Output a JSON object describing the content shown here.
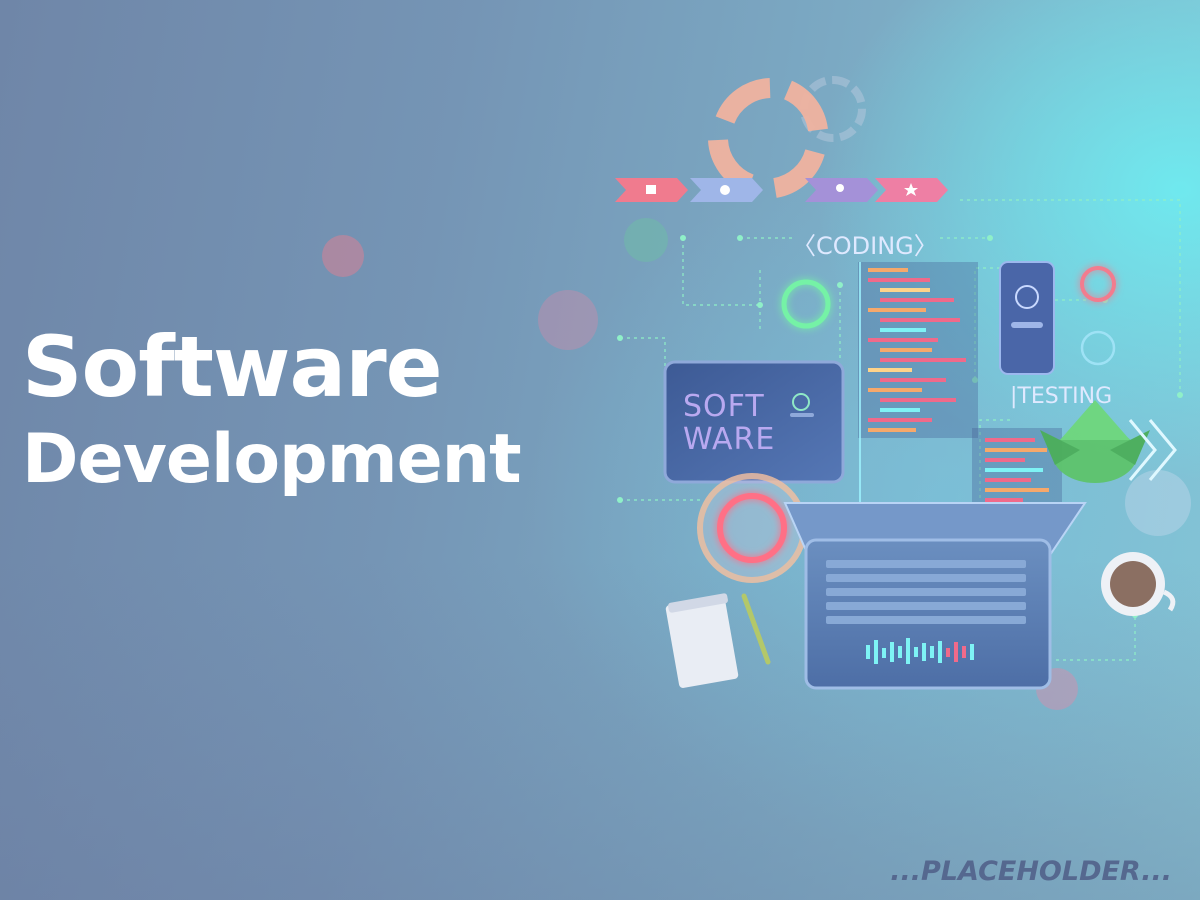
{
  "hero": {
    "title_line1": "Software",
    "title_line2": "Development"
  },
  "illustration": {
    "coding_label": "〈CODING〉",
    "testing_label": "|TESTING",
    "software_label": "SOFT\nWARE",
    "arrow_icons": [
      "home-icon",
      "chart-icon",
      "location-pin-icon",
      "star-icon"
    ]
  },
  "watermark": "...PLACEHOLDER...",
  "colors": {
    "accent_pink": "#f06a8a",
    "accent_cyan": "#7ef3f5",
    "accent_green": "#6cf0a0",
    "accent_lavender": "#b9a9f0"
  }
}
